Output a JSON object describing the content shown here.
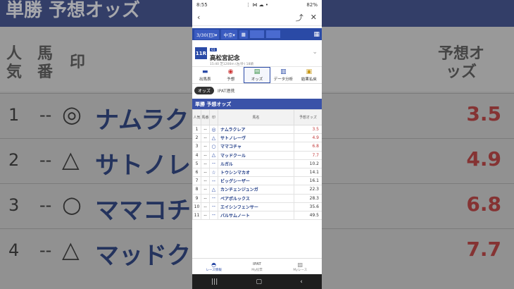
{
  "background": {
    "title": "単勝 予想オッズ",
    "col_headers": [
      "人気",
      "馬番",
      "印",
      "予想オッズ"
    ],
    "rows": [
      {
        "rank": "1",
        "draw": "--",
        "mark": "◎",
        "horse": "ナムラクレア",
        "odds": "3.5"
      },
      {
        "rank": "2",
        "draw": "--",
        "mark": "△",
        "horse": "サトノレーヴ",
        "odds": "4.9"
      },
      {
        "rank": "3",
        "draw": "--",
        "mark": "○",
        "horse": "ママコチャ",
        "odds": "6.8"
      },
      {
        "rank": "4",
        "draw": "--",
        "mark": "△",
        "horse": "マッドクール",
        "odds": "7.7"
      }
    ]
  },
  "status": {
    "time": "8:55",
    "icons": "⋮ ⋈ ☁ •",
    "battery": "82%"
  },
  "appbar": {
    "back": "‹",
    "share": "⤴",
    "close": "✕"
  },
  "filter": {
    "date": "3/30(日)▾",
    "venue": "中京▾",
    "icon": "▦",
    "grid": "▦"
  },
  "race": {
    "number": "11R",
    "grade": "G1",
    "name": "高松宮記念",
    "sub": "15:40 芝1200m (左/外) 18頭",
    "chev": "⌄"
  },
  "tabs": [
    {
      "icon": "▬",
      "label": "出馬表"
    },
    {
      "icon": "◉",
      "label": "予想"
    },
    {
      "icon": "▤",
      "label": "オッズ"
    },
    {
      "icon": "▥",
      "label": "データ分析"
    },
    {
      "icon": "▣",
      "label": "結果払戻"
    }
  ],
  "subtabs": {
    "active": "オッズ",
    "link": "IPAT連携"
  },
  "section_title": "単勝 予想オッズ",
  "table": {
    "headers": [
      "人気",
      "馬番",
      "印",
      "馬名",
      "予想オッズ"
    ],
    "rows": [
      {
        "rank": "1",
        "draw": "--",
        "mark": "◎",
        "horse": "ナムラクレア",
        "odds": "3.5",
        "hot": true
      },
      {
        "rank": "2",
        "draw": "--",
        "mark": "△",
        "horse": "サトノレーヴ",
        "odds": "4.9",
        "hot": true
      },
      {
        "rank": "3",
        "draw": "--",
        "mark": "○",
        "horse": "ママコチャ",
        "odds": "6.8",
        "hot": true
      },
      {
        "rank": "4",
        "draw": "--",
        "mark": "△",
        "horse": "マッドクール",
        "odds": "7.7",
        "hot": true
      },
      {
        "rank": "5",
        "draw": "--",
        "mark": "--",
        "horse": "ルガル",
        "odds": "10.2",
        "hot": false
      },
      {
        "rank": "6",
        "draw": "--",
        "mark": "☆",
        "horse": "トウシンマカオ",
        "odds": "14.1",
        "hot": false
      },
      {
        "rank": "7",
        "draw": "--",
        "mark": "--",
        "horse": "ビッグシーザー",
        "odds": "16.1",
        "hot": false
      },
      {
        "rank": "8",
        "draw": "--",
        "mark": "△",
        "horse": "カンチェンジュンガ",
        "odds": "22.3",
        "hot": false
      },
      {
        "rank": "9",
        "draw": "--",
        "mark": "--",
        "horse": "ペアポルックス",
        "odds": "28.3",
        "hot": false
      },
      {
        "rank": "10",
        "draw": "--",
        "mark": "--",
        "horse": "エイシンフェンサー",
        "odds": "35.6",
        "hot": false
      },
      {
        "rank": "11",
        "draw": "--",
        "mark": "--",
        "horse": "バルサムノート",
        "odds": "49.5",
        "hot": false
      }
    ]
  },
  "bottomnav": [
    {
      "icon": "◓",
      "label": "レース情報"
    },
    {
      "icon": "IPAT",
      "label": "My投票"
    },
    {
      "icon": "▨",
      "label": "Myレース"
    }
  ],
  "sysnav": [
    "|||",
    "▢",
    "‹"
  ]
}
